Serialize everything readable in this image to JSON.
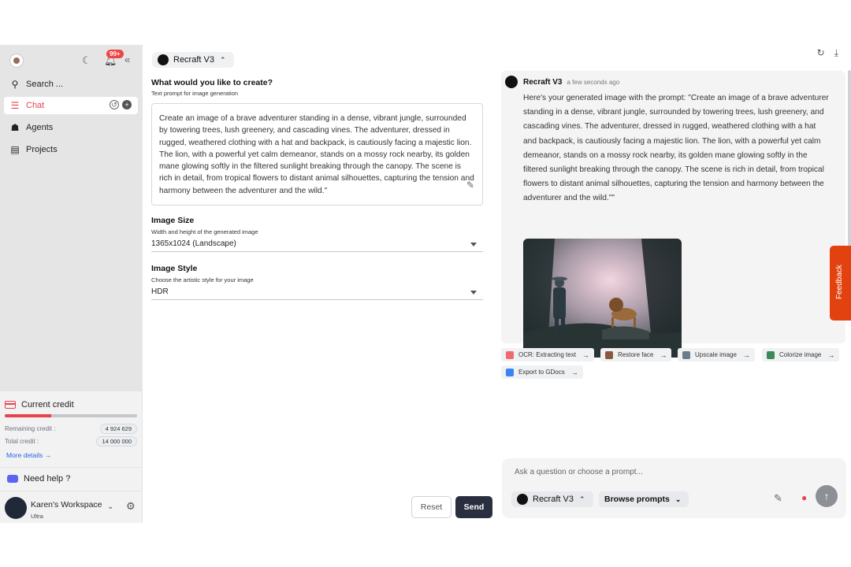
{
  "sidebar": {
    "notification_count": "99+",
    "search_label": "Search ...",
    "items": [
      {
        "label": "Chat"
      },
      {
        "label": "Agents"
      },
      {
        "label": "Projects"
      }
    ],
    "credit": {
      "title": "Current credit",
      "remaining_label": "Remaining credit :",
      "remaining_value": "4 924 629",
      "total_label": "Total credit :",
      "total_value": "14 000 000",
      "used_fraction": 0.35,
      "more_details": "More details"
    },
    "help_label": "Need help ?",
    "workspace": {
      "name": "Karen's Workspace",
      "plan": "Ultra"
    }
  },
  "form": {
    "model": "Recraft V3",
    "prompt_title": "What would you like to create?",
    "prompt_sub": "Text prompt for image generation",
    "prompt_value": "Create an image of a brave adventurer standing in a dense, vibrant jungle, surrounded by towering trees, lush greenery, and cascading vines. The adventurer, dressed in rugged, weathered clothing with a hat and backpack, is cautiously facing a majestic lion. The lion, with a powerful yet calm demeanor, stands on a mossy rock nearby, its golden mane glowing softly in the filtered sunlight breaking through the canopy. The scene is rich in detail, from tropical flowers to distant animal silhouettes, capturing the tension and harmony between the adventurer and the wild.\"",
    "size_title": "Image Size",
    "size_sub": "Width and height of the generated image",
    "size_value": "1365x1024 (Landscape)",
    "style_title": "Image Style",
    "style_sub": "Choose the artistic style for your image",
    "style_value": "HDR",
    "reset_label": "Reset",
    "send_label": "Send"
  },
  "conversation": {
    "bot_name": "Recraft V3",
    "time": "a few seconds ago",
    "message": "Here's your generated image with the prompt: \"Create an image of a brave adventurer standing in a dense, vibrant jungle, surrounded by towering trees, lush greenery, and cascading vines. The adventurer, dressed in rugged, weathered clothing with a hat and backpack, is cautiously facing a majestic lion. The lion, with a powerful yet calm demeanor, stands on a mossy rock nearby, its golden mane glowing softly in the filtered sunlight breaking through the canopy. The scene is rich in detail, from tropical flowers to distant animal silhouettes, capturing the tension and harmony between the adventurer and the wild.\"\"",
    "actions": [
      {
        "label": "OCR: Extracting text",
        "color": "#ef6b6b"
      },
      {
        "label": "Restore face",
        "color": "#8a5a3c"
      },
      {
        "label": "Upscale image",
        "color": "#6b7c8a"
      },
      {
        "label": "Colorize image",
        "color": "#3c8a5a"
      },
      {
        "label": "Export to GDocs",
        "color": "#3b82f6"
      }
    ]
  },
  "chatbox": {
    "placeholder": "Ask a question or choose a prompt...",
    "model": "Recraft V3",
    "browse_label": "Browse prompts"
  },
  "feedback_label": "Feedback",
  "colors": {
    "accent": "#e8424d",
    "send": "#2a2f3f",
    "feedback": "#e2420f"
  }
}
